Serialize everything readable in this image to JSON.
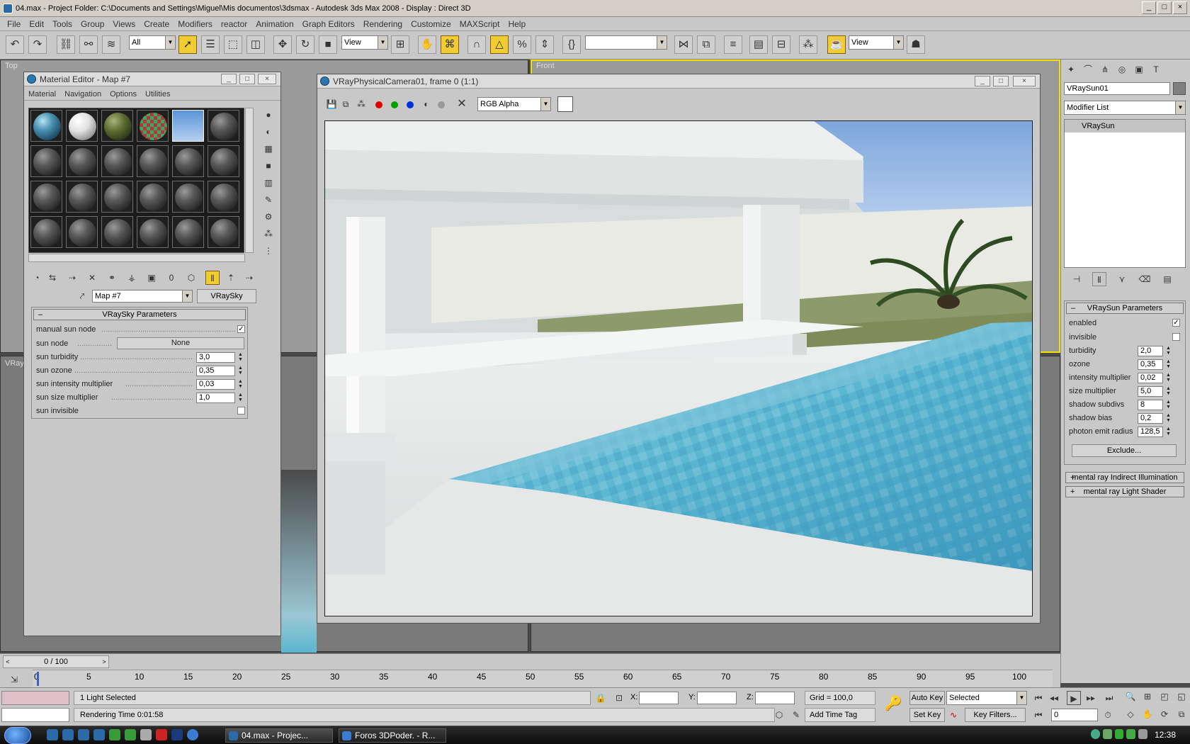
{
  "window": {
    "title": "04.max    - Project Folder: C:\\Documents and Settings\\Miguel\\Mis documentos\\3dsmax    - Autodesk 3ds Max 2008    - Display : Direct 3D"
  },
  "menu": [
    "File",
    "Edit",
    "Tools",
    "Group",
    "Views",
    "Create",
    "Modifiers",
    "reactor",
    "Animation",
    "Graph Editors",
    "Rendering",
    "Customize",
    "MAXScript",
    "Help"
  ],
  "toolbar": {
    "selection_filter": "All",
    "ref_coord": "View",
    "named_set": "",
    "view_dd": "View"
  },
  "viewports": {
    "top_label": "Top",
    "front_label": "Front",
    "persp_label": "VRay"
  },
  "material_editor": {
    "title": "Material Editor - Map #7",
    "menus": [
      "Material",
      "Navigation",
      "Options",
      "Utilities"
    ],
    "map_name": "Map #7",
    "map_type": "VRaySky",
    "rollout_title": "VRaySky Parameters",
    "params": [
      {
        "label": "manual sun node",
        "type": "check",
        "value": "✓"
      },
      {
        "label": "sun node",
        "type": "button",
        "value": "None"
      },
      {
        "label": "sun turbidity",
        "type": "spin",
        "value": "3,0"
      },
      {
        "label": "sun ozone",
        "type": "spin",
        "value": "0,35"
      },
      {
        "label": "sun intensity multiplier",
        "type": "spin",
        "value": "0,03"
      },
      {
        "label": "sun size multiplier",
        "type": "spin",
        "value": "1,0"
      },
      {
        "label": "sun invisible",
        "type": "check",
        "value": ""
      }
    ]
  },
  "frame_buffer": {
    "title": "VRayPhysicalCamera01, frame 0 (1:1)",
    "channel": "RGB Alpha"
  },
  "command_panel": {
    "object_name": "VRaySun01",
    "modifier_list": "Modifier List",
    "stack_item": "VRaySun",
    "rollout_title": "VRaySun Parameters",
    "params": [
      {
        "label": "enabled",
        "type": "check",
        "value": "✓"
      },
      {
        "label": "invisible",
        "type": "check",
        "value": ""
      },
      {
        "label": "turbidity",
        "type": "spin",
        "value": "2,0"
      },
      {
        "label": "ozone",
        "type": "spin",
        "value": "0,35"
      },
      {
        "label": "intensity multiplier",
        "type": "spin",
        "value": "0,02"
      },
      {
        "label": "size multiplier",
        "type": "spin",
        "value": "5,0"
      },
      {
        "label": "shadow subdivs",
        "type": "spin",
        "value": "8"
      },
      {
        "label": "shadow bias",
        "type": "spin",
        "value": "0,2"
      },
      {
        "label": "photon emit radius",
        "type": "spin",
        "value": "128,5"
      }
    ],
    "exclude_btn": "Exclude...",
    "collapsed_rollouts": [
      "mental ray Indirect Illumination",
      "mental ray Light Shader"
    ]
  },
  "timeline": {
    "slider": "0 / 100",
    "ticks": [
      "0",
      "5",
      "10",
      "15",
      "20",
      "25",
      "30",
      "35",
      "40",
      "45",
      "50",
      "55",
      "60",
      "65",
      "70",
      "75",
      "80",
      "85",
      "90",
      "95",
      "100"
    ]
  },
  "status": {
    "selection": "1 Light Selected",
    "prompt": "Rendering Time  0:01:58",
    "x_label": "X:",
    "y_label": "Y:",
    "z_label": "Z:",
    "grid": "Grid = 100,0",
    "add_time_tag": "Add Time Tag",
    "auto_key": "Auto Key",
    "set_key": "Set Key",
    "key_mode": "Selected",
    "key_filters": "Key Filters...",
    "frame": "0"
  },
  "taskbar": {
    "tasks": [
      "04.max     - Projec...",
      "Foros 3DPoder. - R..."
    ],
    "clock": "12:38"
  },
  "colors": {
    "accent_yellow": "#f2cc33",
    "render_sky": "#7fa7dc",
    "pool_water": "#5ab6d0"
  }
}
